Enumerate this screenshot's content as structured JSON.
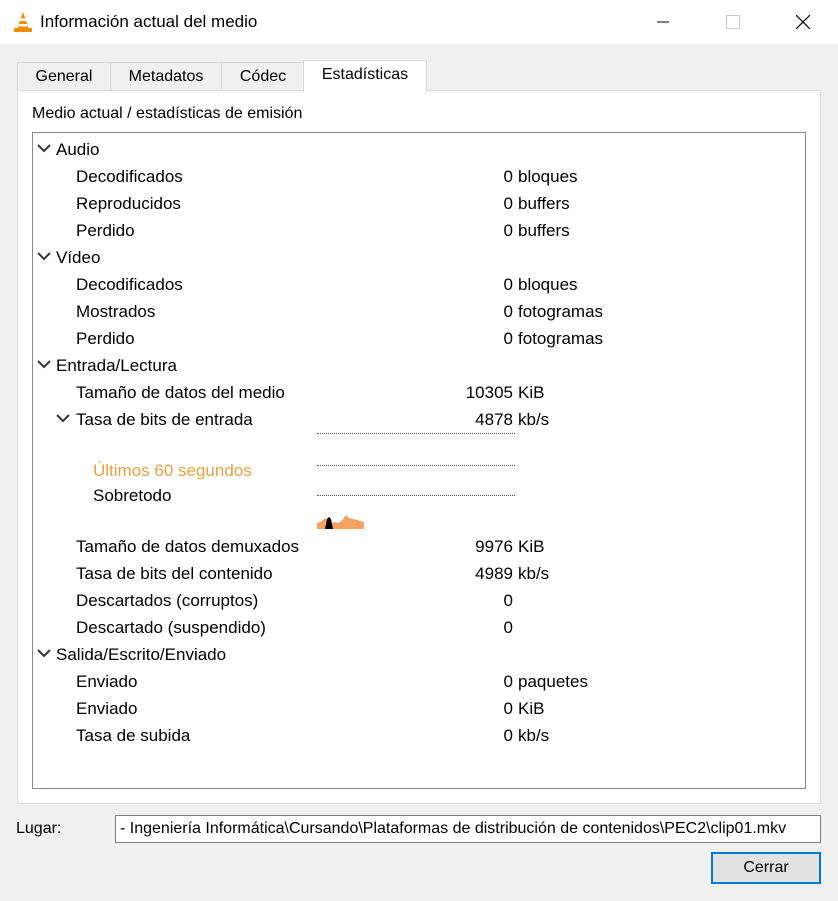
{
  "window": {
    "title": "Información actual del medio"
  },
  "tabs": [
    {
      "label": "General"
    },
    {
      "label": "Metadatos"
    },
    {
      "label": "Códec"
    },
    {
      "label": "Estadísticas"
    }
  ],
  "active_tab": "Estadísticas",
  "panel": {
    "heading": "Medio actual / estadísticas de emisión"
  },
  "stats": {
    "audio": {
      "label": "Audio",
      "rows": [
        {
          "label": "Decodificados",
          "value": "0",
          "unit": "bloques"
        },
        {
          "label": "Reproducidos",
          "value": "0",
          "unit": "buffers"
        },
        {
          "label": "Perdido",
          "value": "0",
          "unit": "buffers"
        }
      ]
    },
    "video": {
      "label": "Vídeo",
      "rows": [
        {
          "label": "Decodificados",
          "value": "0",
          "unit": "bloques"
        },
        {
          "label": "Mostrados",
          "value": "0",
          "unit": "fotogramas"
        },
        {
          "label": "Perdido",
          "value": "0",
          "unit": "fotogramas"
        }
      ]
    },
    "input": {
      "label": "Entrada/Lectura",
      "rows": [
        {
          "label": "Tamaño de datos del medio",
          "value": "10305",
          "unit": "KiB"
        },
        {
          "label": "Tasa de bits de entrada",
          "value": "4878",
          "unit": "kb/s"
        },
        {
          "label": "Tamaño de datos demuxados",
          "value": "9976",
          "unit": "KiB"
        },
        {
          "label": "Tasa de bits del contenido",
          "value": "4989",
          "unit": "kb/s"
        },
        {
          "label": "Descartados (corruptos)",
          "value": "0",
          "unit": ""
        },
        {
          "label": "Descartado (suspendido)",
          "value": "0",
          "unit": ""
        }
      ],
      "graph_legend": {
        "last60": "Últimos 60 segundos",
        "overall": "Sobretodo"
      },
      "colors": {
        "last60": "#e8a040",
        "overall_fill": "#f4a460",
        "overall_peak": "#000000"
      }
    },
    "output": {
      "label": "Salida/Escrito/Enviado",
      "rows": [
        {
          "label": "Enviado",
          "value": "0",
          "unit": "paquetes"
        },
        {
          "label": "Enviado",
          "value": "0",
          "unit": "KiB"
        },
        {
          "label": "Tasa de subida",
          "value": "0",
          "unit": "kb/s"
        }
      ]
    }
  },
  "footer": {
    "location_label": "Lugar:",
    "location_value": "- Ingeniería Informática\\Cursando\\Plataformas de distribución de contenidos\\PEC2\\clip01.mkv",
    "close_label": "Cerrar"
  },
  "icons": {
    "app": "vlc-cone-icon",
    "expand": "chevron-down-icon"
  }
}
